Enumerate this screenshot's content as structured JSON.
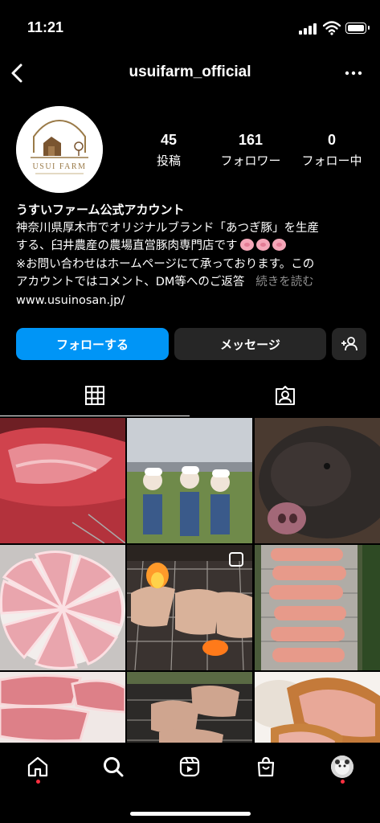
{
  "status_bar": {
    "time": "11:21"
  },
  "header": {
    "username": "usuifarm_official"
  },
  "profile": {
    "logo_text": "USUI FARM",
    "stats": [
      {
        "number": "45",
        "label": "投稿"
      },
      {
        "number": "161",
        "label": "フォロワー"
      },
      {
        "number": "0",
        "label": "フォロー中"
      }
    ],
    "display_name": "うすいファーム公式アカウント",
    "bio_line1": "神奈川県厚木市でオリジナルブランド「あつぎ豚」を生産",
    "bio_line2": "する、臼井農産の農場直営豚肉専門店です",
    "bio_line3": "※お問い合わせはホームページにて承っております。この",
    "bio_line4": "アカウントではコメント、DM等へのご返答",
    "more_label": "続きを読む",
    "website": "www.usuinosan.jp/"
  },
  "actions": {
    "follow_label": "フォローする",
    "message_label": "メッセージ"
  },
  "colors": {
    "follow_button": "#0095f6",
    "secondary_button": "#262626",
    "notification_dot": "#ff3040",
    "muted_text": "#8e8e8e"
  },
  "tabs": [
    "grid-icon",
    "tagged-icon"
  ],
  "grid_posts": [
    "raw-pork-slab",
    "staff-group-photo",
    "pig-closeup",
    "sliced-pork-plate",
    "grilled-pork-bbq",
    "bacon-on-grill",
    "sliced-pork-loin",
    "pork-on-grill",
    "fried-pork-cutlet"
  ],
  "bottom_nav": [
    "home-icon",
    "search-icon",
    "reels-icon",
    "shop-icon",
    "profile-avatar"
  ]
}
